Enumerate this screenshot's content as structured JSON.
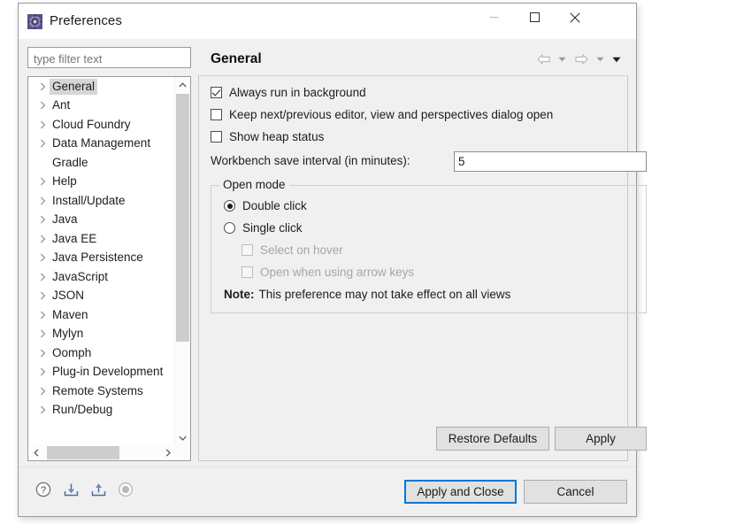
{
  "window": {
    "title": "Preferences",
    "icon": "preferences-gear-icon",
    "controls": {
      "minimize": "minimize-icon",
      "maximize": "maximize-icon",
      "close": "close-icon"
    }
  },
  "filter": {
    "value": "",
    "placeholder": "type filter text"
  },
  "tree": {
    "items": [
      {
        "label": "General",
        "expandable": true,
        "selected": true
      },
      {
        "label": "Ant",
        "expandable": true,
        "selected": false
      },
      {
        "label": "Cloud Foundry",
        "expandable": true,
        "selected": false
      },
      {
        "label": "Data Management",
        "expandable": true,
        "selected": false
      },
      {
        "label": "Gradle",
        "expandable": false,
        "selected": false
      },
      {
        "label": "Help",
        "expandable": true,
        "selected": false
      },
      {
        "label": "Install/Update",
        "expandable": true,
        "selected": false
      },
      {
        "label": "Java",
        "expandable": true,
        "selected": false
      },
      {
        "label": "Java EE",
        "expandable": true,
        "selected": false
      },
      {
        "label": "Java Persistence",
        "expandable": true,
        "selected": false
      },
      {
        "label": "JavaScript",
        "expandable": true,
        "selected": false
      },
      {
        "label": "JSON",
        "expandable": true,
        "selected": false
      },
      {
        "label": "Maven",
        "expandable": true,
        "selected": false
      },
      {
        "label": "Mylyn",
        "expandable": true,
        "selected": false
      },
      {
        "label": "Oomph",
        "expandable": true,
        "selected": false
      },
      {
        "label": "Plug-in Development",
        "expandable": true,
        "selected": false
      },
      {
        "label": "Remote Systems",
        "expandable": true,
        "selected": false
      },
      {
        "label": "Run/Debug",
        "expandable": true,
        "selected": false
      }
    ]
  },
  "pane": {
    "title": "General",
    "nav": {
      "back": "back-arrow-icon",
      "back_menu": "chevron-down-icon",
      "forward": "forward-arrow-icon",
      "forward_menu": "chevron-down-icon",
      "view_menu": "chevron-down-icon"
    },
    "checkboxes": [
      {
        "label": "Always run in background",
        "checked": true,
        "enabled": true
      },
      {
        "label": "Keep next/previous editor, view and perspectives dialog open",
        "checked": false,
        "enabled": true
      },
      {
        "label": "Show heap status",
        "checked": false,
        "enabled": true
      }
    ],
    "save_interval": {
      "label": "Workbench save interval (in minutes):",
      "value": "5"
    },
    "open_mode": {
      "legend": "Open mode",
      "radios": [
        {
          "label": "Double click",
          "checked": true
        },
        {
          "label": "Single click",
          "checked": false
        }
      ],
      "sub_checkboxes": [
        {
          "label": "Select on hover",
          "checked": false,
          "enabled": false
        },
        {
          "label": "Open when using arrow keys",
          "checked": false,
          "enabled": false
        }
      ],
      "note_prefix": "Note:",
      "note_text": "This preference may not take effect on all views"
    },
    "restore_defaults_label": "Restore Defaults",
    "apply_label": "Apply"
  },
  "footer": {
    "help_icon": "help-question-icon",
    "import_icon": "import-icon",
    "export_icon": "export-icon",
    "disabled_icon": "disabled-circle-icon",
    "apply_and_close_label": "Apply and Close",
    "cancel_label": "Cancel"
  },
  "colors": {
    "focus_blue": "#0078d7",
    "dialog_bg": "#f0f0f0",
    "selection_gray": "#d6d6d6",
    "icon_blue": "#4a6f9c"
  }
}
